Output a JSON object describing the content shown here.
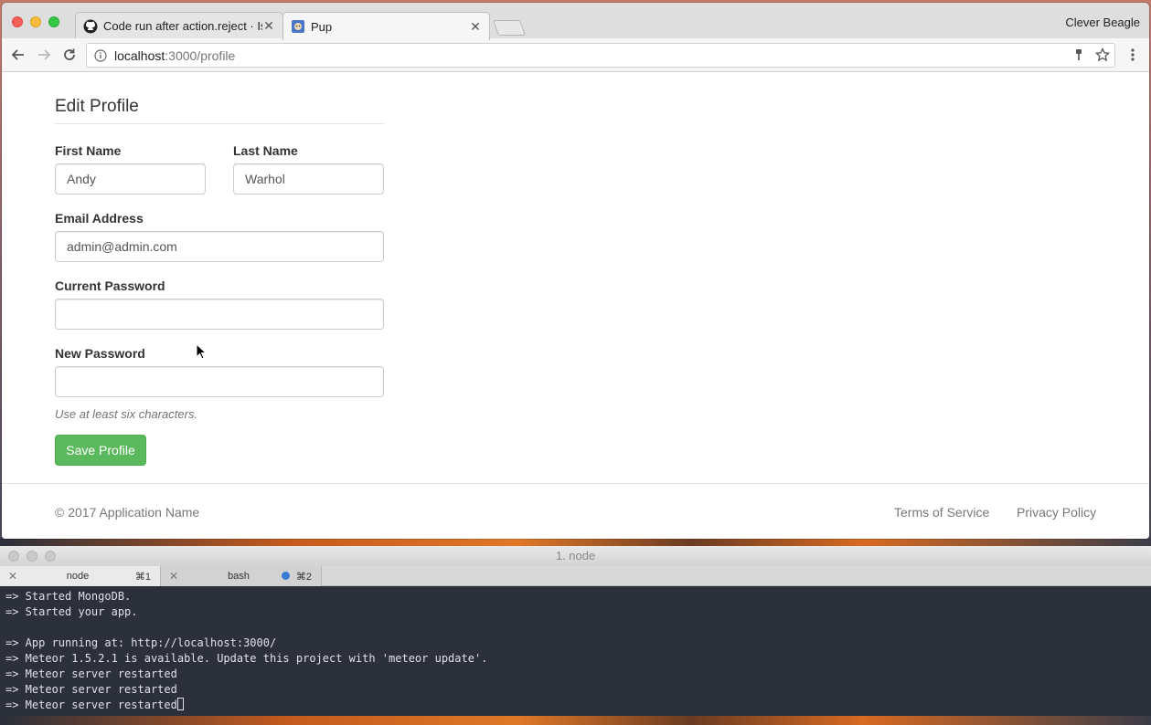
{
  "browser": {
    "tabs": [
      {
        "title": "Code run after action.reject · Is",
        "icon": "github-icon",
        "active": false
      },
      {
        "title": "Pup",
        "icon": "pup-favicon-icon",
        "active": true
      }
    ],
    "profile_name": "Clever Beagle",
    "url_host": "localhost",
    "url_path": ":3000/profile"
  },
  "form": {
    "title": "Edit Profile",
    "first_name_label": "First Name",
    "first_name_value": "Andy",
    "last_name_label": "Last Name",
    "last_name_value": "Warhol",
    "email_label": "Email Address",
    "email_value": "admin@admin.com",
    "current_password_label": "Current Password",
    "new_password_label": "New Password",
    "password_help": "Use at least six characters.",
    "save_label": "Save Profile",
    "save_color": "#5cb85c"
  },
  "footer": {
    "copyright": "© 2017 Application Name",
    "terms": "Terms of Service",
    "privacy": "Privacy Policy"
  },
  "terminal": {
    "title": "1. node",
    "tabs": [
      {
        "name": "node",
        "shortcut": "⌘1"
      },
      {
        "name": "bash",
        "shortcut": "⌘2"
      }
    ],
    "lines": [
      "=> Started MongoDB.",
      "=> Started your app.",
      "",
      "=> App running at: http://localhost:3000/",
      "=> Meteor 1.5.2.1 is available. Update this project with 'meteor update'.",
      "=> Meteor server restarted",
      "=> Meteor server restarted",
      "=> Meteor server restarted"
    ]
  }
}
